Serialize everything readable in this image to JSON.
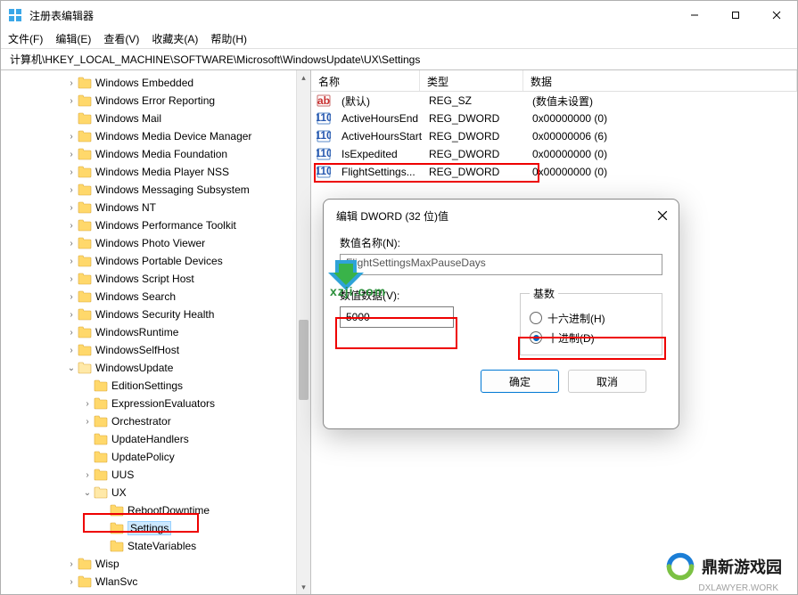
{
  "window": {
    "title": "注册表编辑器"
  },
  "menu": {
    "file": "文件(F)",
    "edit": "编辑(E)",
    "view": "查看(V)",
    "favorites": "收藏夹(A)",
    "help": "帮助(H)"
  },
  "address": "计算机\\HKEY_LOCAL_MACHINE\\SOFTWARE\\Microsoft\\WindowsUpdate\\UX\\Settings",
  "tree": [
    {
      "lvl": 4,
      "exp": ">",
      "label": "Windows Embedded"
    },
    {
      "lvl": 4,
      "exp": ">",
      "label": "Windows Error Reporting"
    },
    {
      "lvl": 4,
      "exp": "",
      "label": "Windows Mail"
    },
    {
      "lvl": 4,
      "exp": ">",
      "label": "Windows Media Device Manager"
    },
    {
      "lvl": 4,
      "exp": ">",
      "label": "Windows Media Foundation"
    },
    {
      "lvl": 4,
      "exp": ">",
      "label": "Windows Media Player NSS"
    },
    {
      "lvl": 4,
      "exp": ">",
      "label": "Windows Messaging Subsystem"
    },
    {
      "lvl": 4,
      "exp": ">",
      "label": "Windows NT"
    },
    {
      "lvl": 4,
      "exp": ">",
      "label": "Windows Performance Toolkit"
    },
    {
      "lvl": 4,
      "exp": ">",
      "label": "Windows Photo Viewer"
    },
    {
      "lvl": 4,
      "exp": ">",
      "label": "Windows Portable Devices"
    },
    {
      "lvl": 4,
      "exp": ">",
      "label": "Windows Script Host"
    },
    {
      "lvl": 4,
      "exp": ">",
      "label": "Windows Search"
    },
    {
      "lvl": 4,
      "exp": ">",
      "label": "Windows Security Health"
    },
    {
      "lvl": 4,
      "exp": ">",
      "label": "WindowsRuntime"
    },
    {
      "lvl": 4,
      "exp": ">",
      "label": "WindowsSelfHost"
    },
    {
      "lvl": 4,
      "exp": "v",
      "label": "WindowsUpdate"
    },
    {
      "lvl": 5,
      "exp": "",
      "label": "EditionSettings"
    },
    {
      "lvl": 5,
      "exp": ">",
      "label": "ExpressionEvaluators"
    },
    {
      "lvl": 5,
      "exp": ">",
      "label": "Orchestrator"
    },
    {
      "lvl": 5,
      "exp": "",
      "label": "UpdateHandlers"
    },
    {
      "lvl": 5,
      "exp": "",
      "label": "UpdatePolicy"
    },
    {
      "lvl": 5,
      "exp": ">",
      "label": "UUS"
    },
    {
      "lvl": 5,
      "exp": "v",
      "label": "UX"
    },
    {
      "lvl": 6,
      "exp": "",
      "label": "RebootDowntime"
    },
    {
      "lvl": 6,
      "exp": "",
      "label": "Settings",
      "selected": true
    },
    {
      "lvl": 6,
      "exp": "",
      "label": "StateVariables"
    },
    {
      "lvl": 4,
      "exp": ">",
      "label": "Wisp"
    },
    {
      "lvl": 4,
      "exp": ">",
      "label": "WlanSvc"
    }
  ],
  "list": {
    "headers": {
      "name": "名称",
      "type": "类型",
      "data": "数据"
    },
    "rows": [
      {
        "icon": "sz",
        "name": "(默认)",
        "type": "REG_SZ",
        "data": "(数值未设置)"
      },
      {
        "icon": "dw",
        "name": "ActiveHoursEnd",
        "type": "REG_DWORD",
        "data": "0x00000000 (0)"
      },
      {
        "icon": "dw",
        "name": "ActiveHoursStart",
        "type": "REG_DWORD",
        "data": "0x00000006 (6)"
      },
      {
        "icon": "dw",
        "name": "IsExpedited",
        "type": "REG_DWORD",
        "data": "0x00000000 (0)"
      },
      {
        "icon": "dw",
        "name": "FlightSettings...",
        "type": "REG_DWORD",
        "data": "0x00000000 (0)"
      }
    ]
  },
  "dialog": {
    "title": "编辑 DWORD (32 位)值",
    "name_label": "数值名称(N):",
    "name_value": "FlightSettingsMaxPauseDays",
    "data_label": "数值数据(V):",
    "data_value": "5000",
    "base_label": "基数",
    "hex": "十六进制(H)",
    "dec": "十进制(D)",
    "ok": "确定",
    "cancel": "取消"
  },
  "watermark1": "xzji.com",
  "watermark2": "鼎新游戏园",
  "watermark3": "DXLAWYER.WORK"
}
